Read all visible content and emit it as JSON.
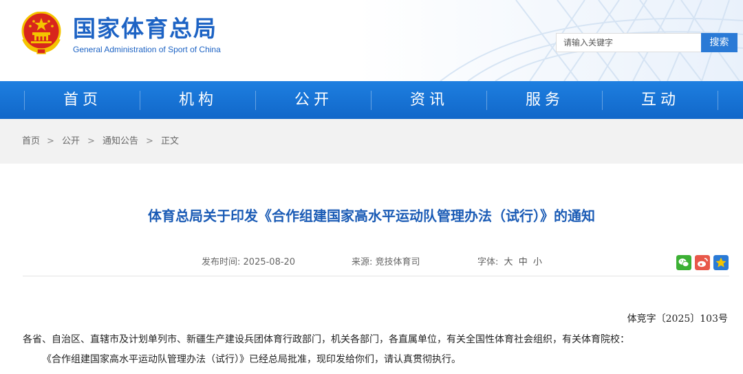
{
  "header": {
    "site_name": "国家体育总局",
    "site_name_en": "General Administration of Sport of China",
    "search_placeholder": "请输入关键字",
    "search_button": "搜索"
  },
  "nav": {
    "items": [
      "首页",
      "机构",
      "公开",
      "资讯",
      "服务",
      "互动"
    ]
  },
  "breadcrumb": {
    "items": [
      "首页",
      "公开",
      "通知公告",
      "正文"
    ],
    "separator": ">"
  },
  "article": {
    "title": "体育总局关于印发《合作组建国家高水平运动队管理办法（试行）》的通知",
    "publish_time_label": "发布时间:",
    "publish_time": "2025-08-20",
    "source_label": "来源:",
    "source": "竞技体育司",
    "font_size_label": "字体:",
    "font_sizes": [
      "大",
      "中",
      "小"
    ],
    "doc_number": "体竞字〔2025〕103号",
    "paragraphs": [
      "各省、自治区、直辖市及计划单列市、新疆生产建设兵团体育行政部门，机关各部门，各直属单位，有关全国性体育社会组织，有关体育院校：",
      "《合作组建国家高水平运动队管理办法（试行）》已经总局批准，现印发给你们，请认真贯彻执行。"
    ]
  },
  "share": {
    "icons": [
      "wechat-icon",
      "weibo-icon",
      "favorite-icon"
    ],
    "colors": {
      "wechat": "#3cb034",
      "weibo": "#e8584a",
      "favorite": "#2a7ad6"
    }
  },
  "colors": {
    "brand_blue": "#1d63c4",
    "nav_blue": "#1673d6",
    "title_blue": "#1a5bb5",
    "breadcrumb_bg": "#f2f2f2"
  }
}
